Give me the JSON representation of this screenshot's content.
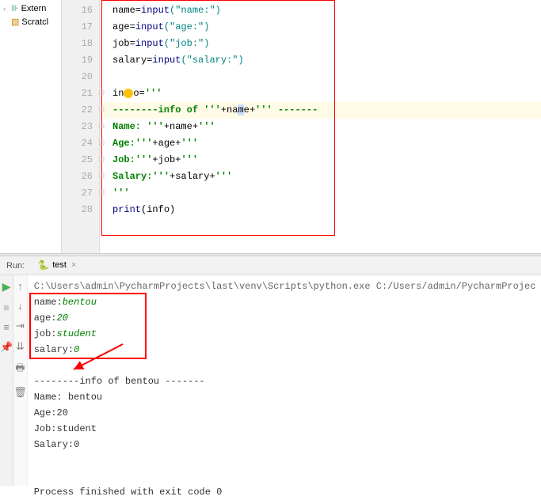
{
  "tree": {
    "external": "Extern",
    "scratches": "Scratcl"
  },
  "gutter": [
    "16",
    "17",
    "18",
    "19",
    "20",
    "21",
    "22",
    "23",
    "24",
    "25",
    "26",
    "27",
    "28"
  ],
  "code": {
    "l16": {
      "prefix": "name=",
      "fn": "input",
      "arg": "(\"name:\")"
    },
    "l17": {
      "prefix": "age=",
      "fn": "input",
      "arg": "(\"age:\")"
    },
    "l18": {
      "prefix": "job=",
      "fn": "input",
      "arg": "(\"job:\")"
    },
    "l19": {
      "prefix": "salary=",
      "fn": "input",
      "arg": "(\"salary:\")"
    },
    "l21": {
      "lhs": "in",
      "rhs": "o=",
      "tq": "'''"
    },
    "l22": {
      "a": "--------info of ",
      "tq1": "'''",
      "plus1": "+na",
      "sel": "m",
      "plus2": "e+",
      "tq2": "'''",
      "b": " -------"
    },
    "l23": {
      "lbl": "Name: ",
      "tq1": "'''",
      "mid": "+name+",
      "tq2": "'''"
    },
    "l24": {
      "lbl": "Age:",
      "tq1": "'''",
      "mid": "+age+",
      "tq2": "'''"
    },
    "l25": {
      "lbl": "Job:",
      "tq1": "'''",
      "mid": "+job+",
      "tq2": "'''"
    },
    "l26": {
      "lbl": "Salary:",
      "tq1": "'''",
      "mid": "+salary+",
      "tq2": "'''"
    },
    "l27": {
      "tq": "'''"
    },
    "l28": {
      "fn": "print",
      "arg": "(info)"
    }
  },
  "run": {
    "label": "Run:",
    "tab": "test",
    "path": "C:\\Users\\admin\\PycharmProjects\\last\\venv\\Scripts\\python.exe C:/Users/admin/PycharmProjec",
    "io": [
      {
        "p": "name:",
        "v": "bentou"
      },
      {
        "p": "age:",
        "v": "20"
      },
      {
        "p": "job:",
        "v": "student"
      },
      {
        "p": "salary:",
        "v": "0"
      }
    ],
    "out": [
      "--------info of bentou -------",
      "Name: bentou",
      "Age:20",
      "Job:student",
      "Salary:0"
    ],
    "exit": "Process finished with exit code 0"
  }
}
